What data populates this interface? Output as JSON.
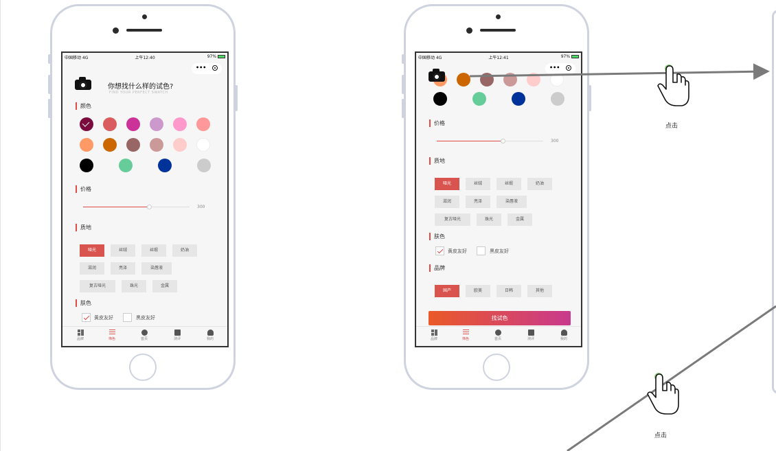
{
  "phone1": {
    "status": {
      "carrier": "中国移动 4G",
      "time": "上午12:40",
      "battery": "97%"
    },
    "question": "你想找什么样的试色?",
    "question_en": "FIND YOUR PERFECT SWATCH",
    "sections": {
      "color": "颜色",
      "price": "价格",
      "texture": "质地",
      "skin": "肤色"
    },
    "swatches": [
      "#7a0b3c",
      "#d95c5e",
      "#cc3399",
      "#cc99cc",
      "#ff99cc",
      "#ff9999",
      "#ff9966",
      "#cc6600",
      "#996666",
      "#cc9999",
      "#ffcccc",
      "#ffffff",
      "#000000",
      "#66cc99",
      "#003399",
      "#cccccc"
    ],
    "price_value": "300",
    "price_level": 0.62,
    "textures": [
      "哑光",
      "丝绒",
      "丝缎",
      "奶油",
      "滋润",
      "亮泽",
      "染唇液",
      "复古哑光",
      "珠光",
      "金属"
    ],
    "skin": [
      "黄皮友好",
      "黑皮友好"
    ],
    "tabs": [
      "品牌",
      "筛色",
      "首页",
      "测评",
      "我的"
    ]
  },
  "phone2": {
    "status": {
      "carrier": "中国移动 4G",
      "time": "上午12:41",
      "battery": "97%"
    },
    "sections": {
      "price": "价格",
      "texture": "质地",
      "skin": "肤色",
      "brand": "品牌"
    },
    "swatches": [
      "#ff9966",
      "#cc6600",
      "#996666",
      "#cc9999",
      "#ffcccc",
      "#ffffff",
      "#000000",
      "#66cc99",
      "#003399",
      "#cccccc"
    ],
    "price_value": "300",
    "price_level": 0.62,
    "textures": [
      "哑光",
      "丝绒",
      "丝缎",
      "奶油",
      "滋润",
      "亮泽",
      "染唇液",
      "复古哑光",
      "珠光",
      "金属"
    ],
    "skin": [
      "黄皮友好",
      "黑皮友好"
    ],
    "brands": [
      "国产",
      "欧美",
      "日韩",
      "其他"
    ],
    "find_button": "找试色",
    "tabs": [
      "品牌",
      "筛色",
      "首页",
      "测评",
      "我的"
    ]
  },
  "annotations": {
    "click_top": "点击",
    "click_bottom": "点击"
  },
  "colors": {
    "accent": "#d9534f",
    "arrow": "#7a7a7a",
    "phone_frame": "#ced3df"
  },
  "icons": [
    "camera-icon",
    "more-dots-icon",
    "record-icon",
    "check-icon",
    "grid-icon",
    "filter-icon",
    "home-icon",
    "chat-icon",
    "user-icon",
    "hand-pointer-icon",
    "arrow-icon"
  ]
}
